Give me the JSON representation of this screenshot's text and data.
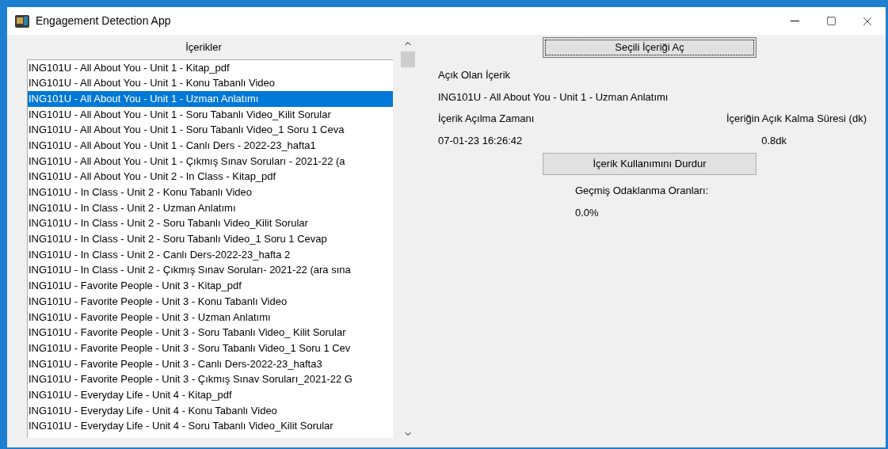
{
  "window": {
    "title": "Engagement Detection App"
  },
  "list": {
    "heading": "İçerikler",
    "items": [
      {
        "label": "ING101U - All About You - Unit 1 - Kitap_pdf",
        "selected": false
      },
      {
        "label": "ING101U - All About You - Unit 1 - Konu Tabanlı Video",
        "selected": false
      },
      {
        "label": "ING101U - All About You - Unit 1 - Uzman Anlatımı",
        "selected": true
      },
      {
        "label": "ING101U - All About You - Unit 1 - Soru Tabanlı Video_Kilit Sorular",
        "selected": false
      },
      {
        "label": "ING101U - All About You - Unit 1 - Soru Tabanlı Video_1 Soru 1 Ceva",
        "selected": false
      },
      {
        "label": "ING101U - All About You - Unit 1 - Canlı Ders - 2022-23_hafta1",
        "selected": false
      },
      {
        "label": "ING101U - All About You - Unit 1 - Çıkmış Sınav Soruları - 2021-22 (a",
        "selected": false
      },
      {
        "label": "ING101U - All About You - Unit 2 - In Class - Kitap_pdf",
        "selected": false
      },
      {
        "label": "ING101U - In Class - Unit 2 - Konu Tabanlı Video",
        "selected": false
      },
      {
        "label": "ING101U - In Class - Unit 2  - Uzman Anlatımı",
        "selected": false
      },
      {
        "label": "ING101U - In Class - Unit 2 - Soru Tabanlı Video_Kilit Sorular",
        "selected": false
      },
      {
        "label": "ING101U - In Class - Unit 2 -  Soru Tabanlı Video_1 Soru 1 Cevap",
        "selected": false
      },
      {
        "label": "ING101U - In Class - Unit 2 - Canlı Ders-2022-23_hafta 2",
        "selected": false
      },
      {
        "label": "ING101U - In Class - Unit 2 - Çıkmış Sınav Soruları- 2021-22 (ara sına",
        "selected": false
      },
      {
        "label": "ING101U - Favorite People - Unit 3 - Kitap_pdf",
        "selected": false
      },
      {
        "label": "ING101U - Favorite People - Unit 3 - Konu Tabanlı Video",
        "selected": false
      },
      {
        "label": "ING101U - Favorite People - Unit 3 - Uzman Anlatımı",
        "selected": false
      },
      {
        "label": "ING101U - Favorite People - Unit 3 - Soru Tabanlı Video_ Kilit Sorular",
        "selected": false
      },
      {
        "label": "ING101U - Favorite People - Unit 3 - Soru Tabanlı Video_1 Soru 1 Cev",
        "selected": false
      },
      {
        "label": "ING101U - Favorite People - Unit 3 - Canlı Ders-2022-23_hafta3",
        "selected": false
      },
      {
        "label": "ING101U - Favorite People - Unit 3 - Çıkmış Sınav Soruları_2021-22 G",
        "selected": false
      },
      {
        "label": "ING101U - Everyday Life - Unit 4 - Kitap_pdf",
        "selected": false
      },
      {
        "label": "ING101U - Everyday Life - Unit 4 - Konu Tabanlı Video",
        "selected": false
      },
      {
        "label": "ING101U - Everyday Life - Unit 4 - Soru Tabanlı Video_Kilit Sorular",
        "selected": false
      }
    ]
  },
  "open_button": "Seçili İçeriği Aç",
  "open_content": {
    "label": "Açık Olan İçerik",
    "value": "ING101U - All About You - Unit 1 - Uzman Anlatımı"
  },
  "open_time": {
    "label": "İçerik Açılma Zamanı",
    "value": "07-01-23 16:26:42"
  },
  "duration": {
    "label": "İçeriğin Açık Kalma Süresi (dk)",
    "value": "0.8dk"
  },
  "stop_button": "İçerik Kullanımını Durdur",
  "history": {
    "label": "Geçmiş Odaklanma Oranları:",
    "value": "0.0%"
  }
}
